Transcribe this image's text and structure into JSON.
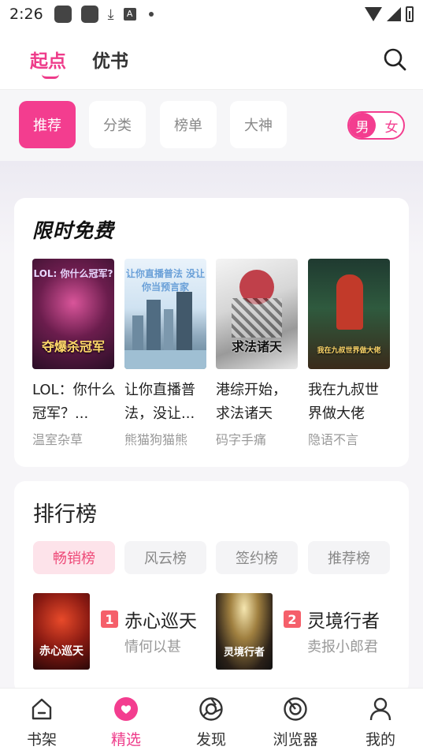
{
  "status_bar": {
    "time": "2:26",
    "icons": [
      "app-icon",
      "app-icon",
      "download-icon",
      "a-icon",
      "dot-icon",
      "wifi-icon",
      "signal-icon",
      "battery-icon"
    ]
  },
  "top_nav": {
    "tabs": [
      {
        "label": "起点",
        "active": true
      },
      {
        "label": "优书",
        "active": false
      }
    ],
    "search_icon": "search-icon"
  },
  "categories": {
    "chips": [
      {
        "label": "推荐",
        "active": true
      },
      {
        "label": "分类",
        "active": false
      },
      {
        "label": "榜单",
        "active": false
      },
      {
        "label": "大神",
        "active": false
      }
    ],
    "gender_toggle": {
      "male": "男",
      "female": "女",
      "selected": "男"
    }
  },
  "free_section": {
    "title": "限时免费",
    "books": [
      {
        "title": "LOL：你什么冠军？...",
        "author": "温室杂草",
        "cover_text": "夺爆杀冠军",
        "cover_top": "LOL: 你什么冠军?"
      },
      {
        "title": "让你直播普法，没让...",
        "author": "熊猫狗猫熊",
        "cover_text": "",
        "cover_top": "让你直播普法 没让你当预言家"
      },
      {
        "title": "港综开始，求法诸天",
        "author": "码字手痛",
        "cover_text": "求法诸天",
        "cover_top": ""
      },
      {
        "title": "我在九叔世界做大佬",
        "author": "隐语不言",
        "cover_text": "我在九叔世界做大佬",
        "cover_top": ""
      }
    ]
  },
  "rank_section": {
    "title": "排行榜",
    "tabs": [
      {
        "label": "畅销榜",
        "active": true
      },
      {
        "label": "风云榜",
        "active": false
      },
      {
        "label": "签约榜",
        "active": false
      },
      {
        "label": "推荐榜",
        "active": false
      }
    ],
    "items": [
      {
        "rank": "1",
        "title": "赤心巡天",
        "author": "情何以甚",
        "cover_text": "赤心巡天"
      },
      {
        "rank": "2",
        "title": "灵境行者",
        "author": "卖报小郎君",
        "cover_text": "灵境行者"
      }
    ]
  },
  "bottom_nav": {
    "items": [
      {
        "label": "书架",
        "icon": "home-icon",
        "active": false
      },
      {
        "label": "精选",
        "icon": "heart-icon",
        "active": true
      },
      {
        "label": "发现",
        "icon": "compass-icon",
        "active": false
      },
      {
        "label": "浏览器",
        "icon": "browser-icon",
        "active": false
      },
      {
        "label": "我的",
        "icon": "user-icon",
        "active": false
      }
    ]
  },
  "colors": {
    "accent": "#f33d8f",
    "rank_tab_active_bg": "#fde3ea",
    "rank_badge": "#f55f6a"
  }
}
